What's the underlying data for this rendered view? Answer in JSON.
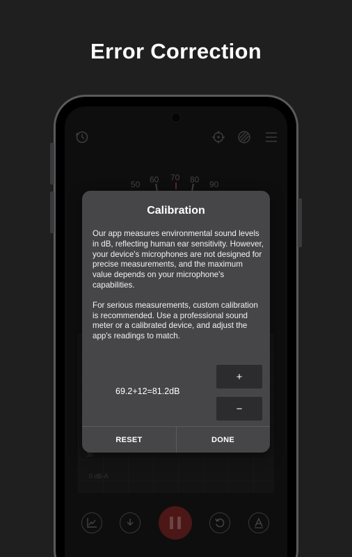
{
  "promo": {
    "title": "Error Correction"
  },
  "gauge": {
    "labels": [
      "50",
      "60",
      "70",
      "80",
      "90"
    ]
  },
  "graph": {
    "labels": [
      "30",
      "0 dB-A"
    ]
  },
  "dialog": {
    "title": "Calibration",
    "paragraph1": "Our app measures environmental sound levels in dB, reflecting human ear sensitivity. However, your device's microphones are not designed for precise measurements, and the maximum value depends on your microphone's capabilities.",
    "paragraph2": "For serious measurements, custom calibration is recommended. Use a professional sound meter or a calibrated device, and adjust the app's readings to match.",
    "formula": "69.2+12=81.2dB",
    "plus_label": "+",
    "minus_label": "−",
    "reset_label": "RESET",
    "done_label": "DONE"
  },
  "colors": {
    "background": "#1f1f20",
    "dialog": "#464648",
    "stepper": "#2c2c2e",
    "record_button": "#8a2a2a"
  },
  "icons": {
    "top_left": "history-timer-icon",
    "top_right": [
      "crosshair-icon",
      "striped-circle-icon",
      "menu-icon"
    ],
    "bottom": [
      "chart-icon",
      "download-icon",
      "pause-icon",
      "reset-icon",
      "font-a-icon"
    ]
  }
}
